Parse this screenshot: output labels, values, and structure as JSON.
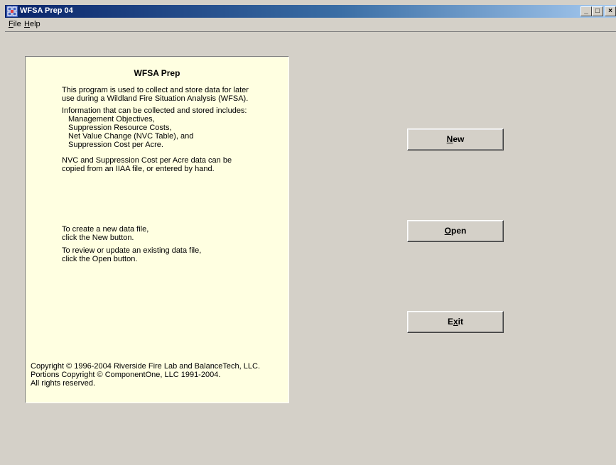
{
  "window": {
    "title": "WFSA Prep 04",
    "minimize_glyph": "_",
    "maximize_glyph": "□",
    "close_glyph": "×"
  },
  "menu": {
    "file": {
      "accel": "F",
      "rest": "ile"
    },
    "help": {
      "accel": "H",
      "rest": "elp"
    }
  },
  "panel": {
    "title": "WFSA Prep",
    "intro_1": "This program is used to collect and store data for later",
    "intro_2": "use during a Wildland Fire Situation Analysis (WFSA).",
    "collect_heading": "Information that can be collected and stored includes:",
    "collect_items": [
      "Management Objectives,",
      "Suppression Resource Costs,",
      "Net Value Change (NVC Table), and",
      "Suppression Cost per Acre."
    ],
    "nvc_1": "NVC and Suppression Cost per Acre data can be",
    "nvc_2": "copied from an IIAA file, or entered by hand.",
    "new_hint_1": "To create a new data file,",
    "new_hint_2": "click the New button.",
    "open_hint_1": "To review or update an existing data file,",
    "open_hint_2": "click the Open button.",
    "copyright_1": "Copyright © 1996-2004 Riverside Fire Lab and BalanceTech, LLC.",
    "copyright_2": "Portions Copyright © ComponentOne, LLC 1991-2004.",
    "copyright_3": "All rights reserved."
  },
  "buttons": {
    "new": {
      "accel": "N",
      "rest": "ew"
    },
    "open": {
      "accel": "O",
      "rest": "pen"
    },
    "exit": {
      "pre": "E",
      "accel": "x",
      "rest": "it"
    }
  },
  "icons": {
    "app": "app-grid-icon"
  },
  "colors": {
    "title_bar_start": "#0a246a",
    "title_bar_end": "#a6caf0",
    "face": "#d4d0c8",
    "panel_bg": "#ffffe1"
  }
}
